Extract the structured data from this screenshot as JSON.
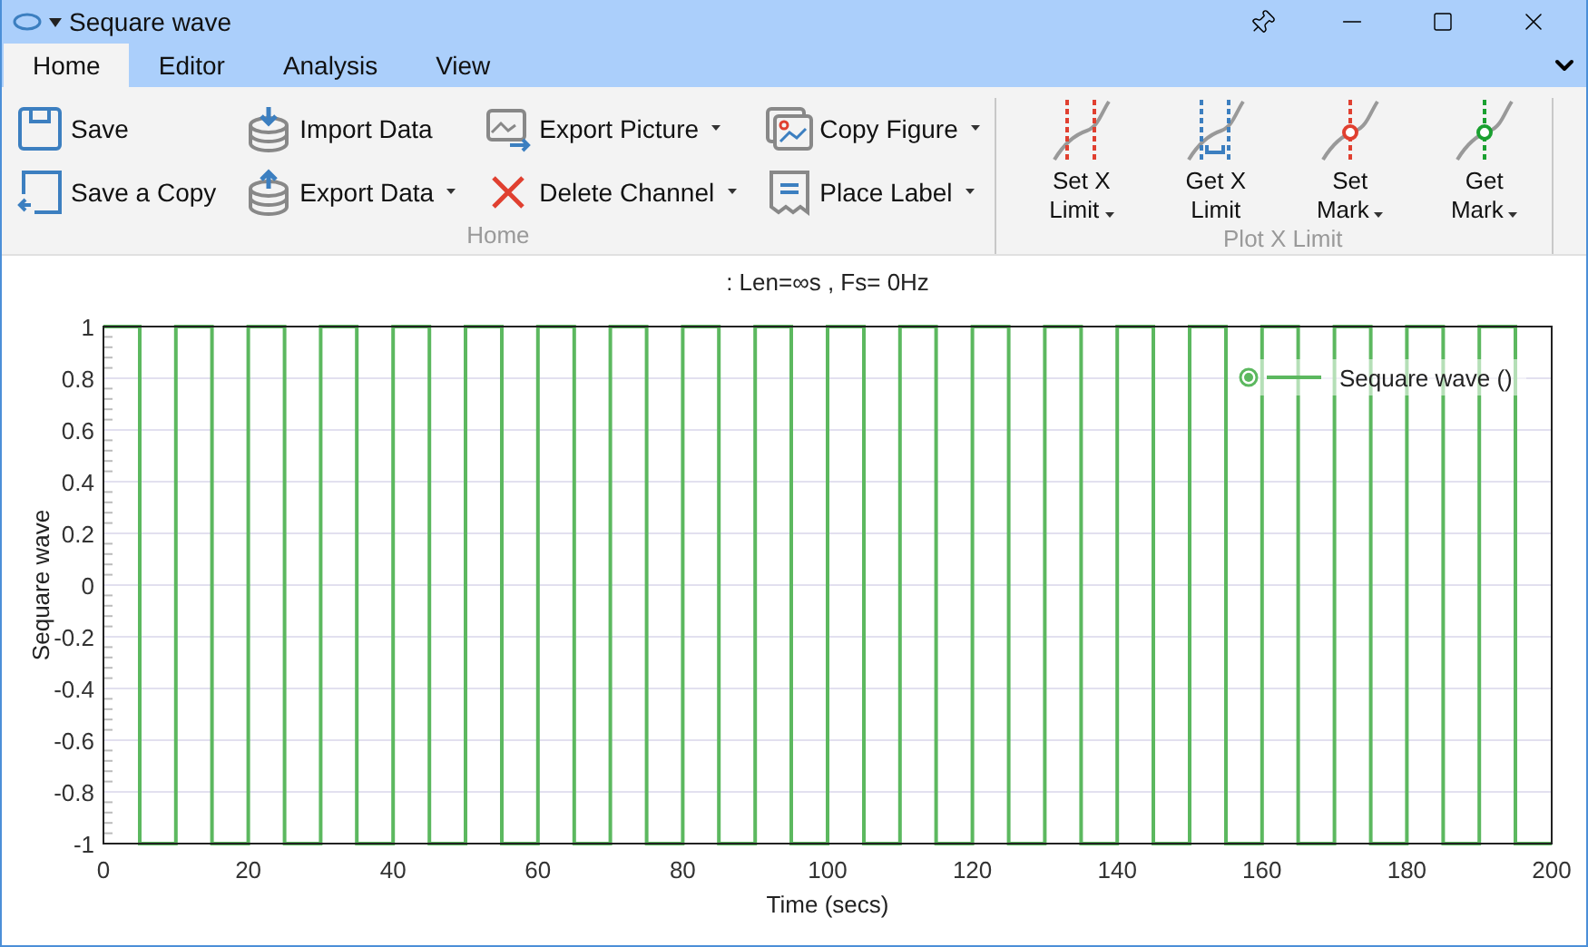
{
  "window": {
    "title": "Sequare wave"
  },
  "tabs": [
    {
      "label": "Home",
      "selected": true
    },
    {
      "label": "Editor",
      "selected": false
    },
    {
      "label": "Analysis",
      "selected": false
    },
    {
      "label": "View",
      "selected": false
    }
  ],
  "ribbon": {
    "groups": [
      {
        "label": "Home",
        "kind": "small",
        "items": [
          {
            "label": "Save",
            "dropdown": false
          },
          {
            "label": "Save a Copy",
            "dropdown": false
          },
          {
            "label": "Import Data",
            "dropdown": false
          },
          {
            "label": "Export Data",
            "dropdown": true
          },
          {
            "label": "Export Picture",
            "dropdown": true
          },
          {
            "label": "Delete Channel",
            "dropdown": true
          },
          {
            "label": "Copy Figure",
            "dropdown": true
          },
          {
            "label": "Place Label",
            "dropdown": true
          }
        ]
      },
      {
        "label": "Plot X Limit",
        "kind": "large",
        "items": [
          {
            "label": "Set X\nLimit",
            "dropdown": true
          },
          {
            "label": "Get X\nLimit",
            "dropdown": false
          },
          {
            "label": "Set\nMark",
            "dropdown": true
          },
          {
            "label": "Get\nMark",
            "dropdown": true
          }
        ]
      }
    ]
  },
  "plot": {
    "chart_data": {
      "type": "line",
      "title": ": Len=∞s , Fs= 0Hz",
      "xlabel": "Time (secs)",
      "ylabel": "Sequare wave",
      "grid": true,
      "xlim": [
        0,
        200
      ],
      "ylim": [
        -1,
        1
      ],
      "xticks": [
        0,
        20,
        40,
        60,
        80,
        100,
        120,
        140,
        160,
        180,
        200
      ],
      "yticks": [
        -1,
        -0.8,
        -0.6,
        -0.4,
        -0.2,
        0,
        0.2,
        0.4,
        0.6,
        0.8,
        1
      ],
      "x": [
        0,
        5,
        5,
        10,
        10,
        15,
        15,
        20,
        20,
        25,
        25,
        30,
        30,
        35,
        35,
        40,
        40,
        45,
        45,
        50,
        50,
        55,
        55,
        60,
        60,
        65,
        65,
        70,
        70,
        75,
        75,
        80,
        80,
        85,
        85,
        90,
        90,
        95,
        95,
        100,
        100,
        105,
        105,
        110,
        110,
        115,
        115,
        120,
        120,
        125,
        125,
        130,
        130,
        135,
        135,
        140,
        140,
        145,
        145,
        150,
        150,
        155,
        155,
        160,
        160,
        165,
        165,
        170,
        170,
        175,
        175,
        180,
        180,
        185,
        185,
        190,
        190,
        195,
        195,
        200
      ],
      "series": [
        {
          "name": "Sequare wave ()",
          "color": "#5cb85f",
          "values": [
            1,
            1,
            -1,
            -1,
            1,
            1,
            -1,
            -1,
            1,
            1,
            -1,
            -1,
            1,
            1,
            -1,
            -1,
            1,
            1,
            -1,
            -1,
            1,
            1,
            -1,
            -1,
            1,
            1,
            -1,
            -1,
            1,
            1,
            -1,
            -1,
            1,
            1,
            -1,
            -1,
            1,
            1,
            -1,
            -1,
            1,
            1,
            -1,
            -1,
            1,
            1,
            -1,
            -1,
            1,
            1,
            -1,
            -1,
            1,
            1,
            -1,
            -1,
            1,
            1,
            -1,
            -1,
            1,
            1,
            -1,
            -1,
            1,
            1,
            -1,
            -1,
            1,
            1,
            -1,
            -1,
            1,
            1,
            -1,
            -1,
            1,
            1,
            -1,
            -1
          ]
        }
      ]
    }
  }
}
